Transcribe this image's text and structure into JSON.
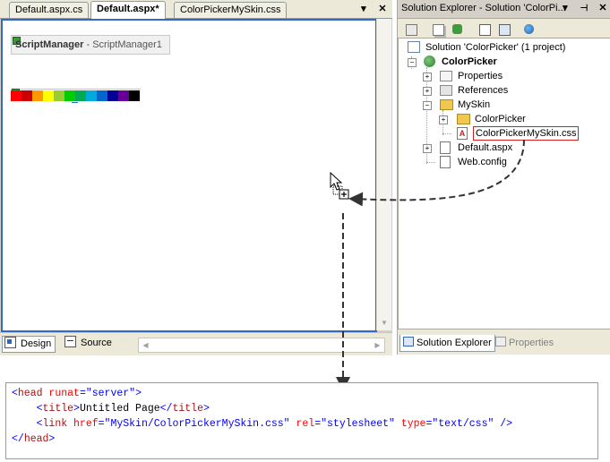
{
  "designer": {
    "tabs": [
      {
        "label": "Default.aspx.cs",
        "active": false
      },
      {
        "label": "Default.aspx*",
        "active": true
      },
      {
        "label": "ColorPickerMySkin.css",
        "active": false
      }
    ],
    "controls": {
      "dropdown_icon": "dropdown-arrow-icon",
      "close_icon": "close-icon"
    },
    "script_manager": {
      "type_label": "ScriptManager",
      "id_label": "- ScriptManager1"
    },
    "color_picker": {
      "swatches": [
        "#ff0000",
        "#cc0000",
        "#ff9900",
        "#ffff00",
        "#99cc33",
        "#00cc00",
        "#00aa55",
        "#00aadd",
        "#0066cc",
        "#000099",
        "#660099",
        "#000000"
      ]
    },
    "view_tabs": [
      {
        "label": "Design",
        "active": true,
        "icon": "design-view-icon"
      },
      {
        "label": "Source",
        "active": false,
        "icon": "source-view-icon"
      }
    ]
  },
  "solution_explorer": {
    "title": "Solution Explorer - Solution 'ColorPi...",
    "title_controls": {
      "dropdown_icon": "dropdown-arrow-icon",
      "pin_icon": "pin-icon",
      "close_icon": "close-icon"
    },
    "toolbar": [
      "properties-icon",
      "show-all-files-icon",
      "refresh-icon",
      "view-code-icon",
      "view-designer-icon",
      "copy-website-icon"
    ],
    "tree": {
      "solution": "Solution 'ColorPicker' (1 project)",
      "project": "ColorPicker",
      "items": [
        "Properties",
        "References",
        "MySkin",
        "ColorPicker",
        "ColorPickerMySkin.css",
        "Default.aspx",
        "Web.config"
      ],
      "selected": "ColorPickerMySkin.css"
    },
    "bottom_tabs": [
      {
        "label": "Solution Explorer",
        "active": true
      },
      {
        "label": "Properties",
        "active": false
      }
    ]
  },
  "code": {
    "line1": {
      "open": "<",
      "tag": "head",
      "attr": " runat",
      "eq": "=",
      "val": "\"server\"",
      "close": ">"
    },
    "line2": {
      "indent": "    ",
      "o1": "<",
      "tag1": "title",
      "c1": ">",
      "text": "Untitled Page",
      "o2": "</",
      "tag2": "title",
      "c2": ">"
    },
    "line3": {
      "indent": "    ",
      "open": "<",
      "tag": "link",
      "a1": " href",
      "e1": "=",
      "v1": "\"MySkin/ColorPickerMySkin.css\"",
      "a2": " rel",
      "e2": "=",
      "v2": "\"stylesheet\"",
      "a3": " type",
      "e3": "=",
      "v3": "\"text/css\"",
      "close": " />"
    },
    "line4": {
      "open": "</",
      "tag": "head",
      "close": ">"
    }
  },
  "colors": {
    "selection_border": "#316ac5",
    "selected_item_border": "#d81e1e",
    "folder": "#f0c850"
  }
}
